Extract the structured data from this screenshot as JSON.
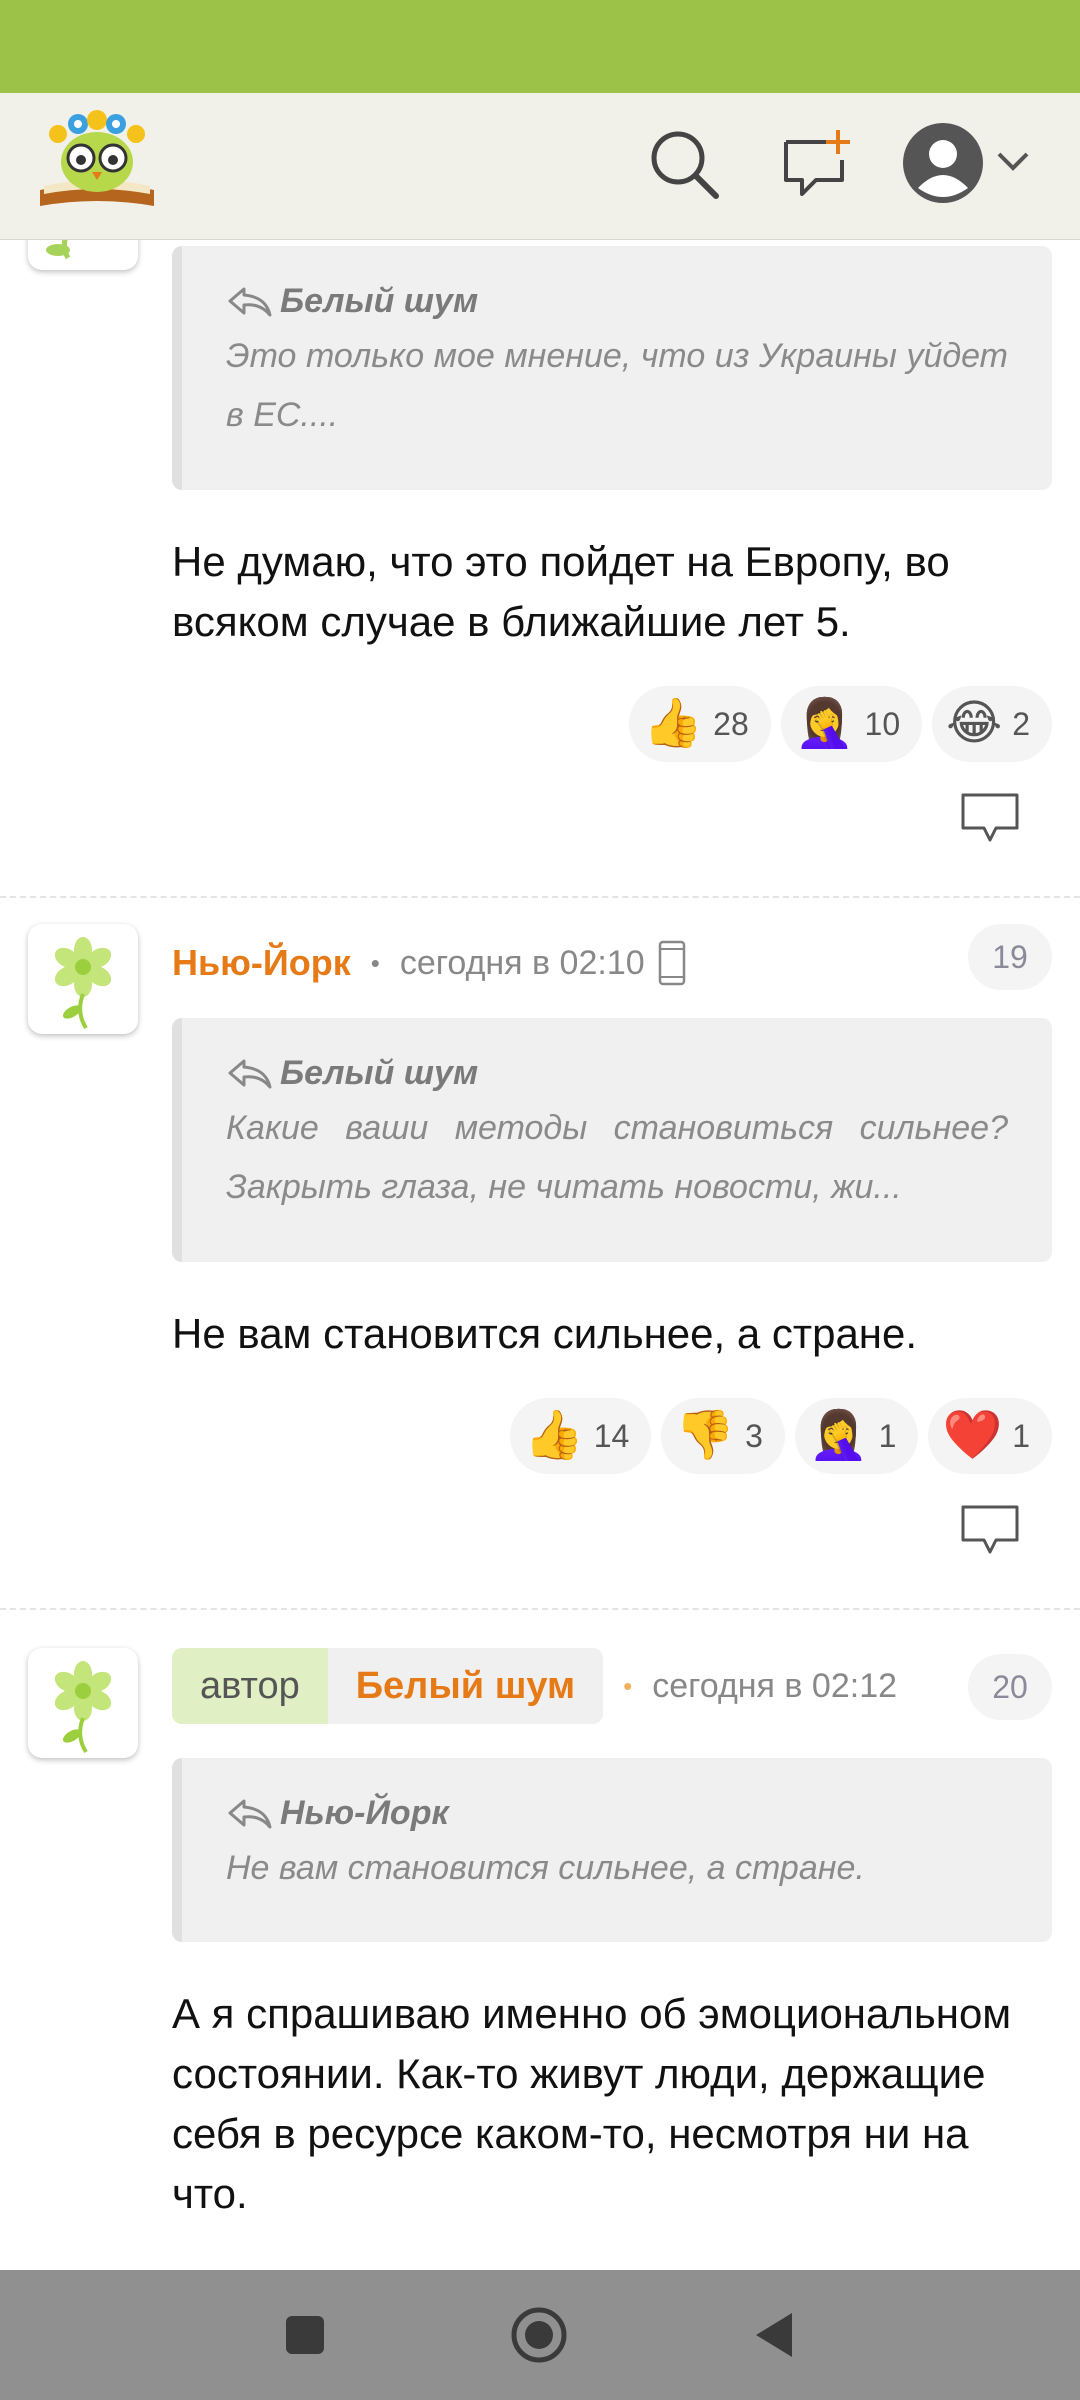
{
  "icons": {
    "logo": "owl-books-logo",
    "search": "search-icon",
    "new_message": "new-message-icon",
    "profile": "user-avatar-icon",
    "profile_menu": "chevron-down-icon",
    "reply": "reply-arrow-icon",
    "comment": "comment-bubble-icon",
    "device": "mobile-phone-icon"
  },
  "colors": {
    "status_bar": "#9dc248",
    "header_bg": "#f1f1ea",
    "username": "#e57a17",
    "author_tag": "#e1efc4",
    "nav_bar": "#909090"
  },
  "comments": [
    {
      "quote": {
        "author": "Белый шум",
        "text": "Это только мое мнение, что из Украины уйдет в ЕС...."
      },
      "text": "Не думаю, что это пойдет на Европу, во всяком случае в ближайшие лет 5.",
      "reactions": [
        {
          "emoji": "👍",
          "name": "thumbs-up",
          "count": "28"
        },
        {
          "emoji": "🤦‍♀️",
          "name": "facepalm",
          "count": "10"
        },
        {
          "emoji": "😂",
          "name": "laughing",
          "count": "2"
        }
      ]
    },
    {
      "username": "Нью-Йорк",
      "time": "сегодня в 02:10",
      "number": "19",
      "quote": {
        "author": "Белый шум",
        "text": "Какие ваши методы становиться сильнее? Закрыть глаза, не читать новости, жи..."
      },
      "text": "Не вам становится сильнее, а стране.",
      "reactions": [
        {
          "emoji": "👍",
          "name": "thumbs-up",
          "count": "14"
        },
        {
          "emoji": "👎",
          "name": "thumbs-down",
          "count": "3"
        },
        {
          "emoji": "🤦‍♀️",
          "name": "facepalm",
          "count": "1"
        },
        {
          "emoji": "❤️",
          "name": "heart",
          "count": "1"
        }
      ]
    },
    {
      "author_label": "автор",
      "username": "Белый шум",
      "time": "сегодня в 02:12",
      "number": "20",
      "quote": {
        "author": "Нью-Йорк",
        "text": "Не вам становится сильнее, а стране."
      },
      "text": "А я спрашиваю именно об эмоциональном состоянии. Как-то живут люди, держащие себя в ресурсе каком-то, несмотря ни на что."
    }
  ]
}
